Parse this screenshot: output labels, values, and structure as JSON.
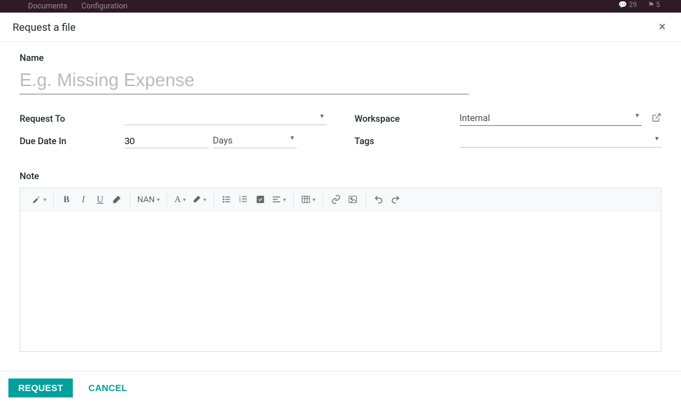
{
  "topbar": {
    "nav": [
      "Documents",
      "Configuration"
    ],
    "badge1": "29",
    "badge2": "5"
  },
  "modal": {
    "title": "Request a file",
    "close_glyph": "×"
  },
  "fields": {
    "name_label": "Name",
    "name_placeholder": "E.g. Missing Expense",
    "name_value": "",
    "request_to_label": "Request To",
    "request_to_value": "",
    "due_date_label": "Due Date In",
    "due_date_number": "30",
    "due_date_unit": "Days",
    "workspace_label": "Workspace",
    "workspace_value": "Internal",
    "tags_label": "Tags",
    "tags_value": "",
    "note_label": "Note"
  },
  "editor": {
    "style_label": "NAN",
    "font_letter": "A",
    "bold": "B",
    "italic": "I",
    "underline": "U"
  },
  "footer": {
    "primary": "Request",
    "secondary": "Cancel"
  }
}
